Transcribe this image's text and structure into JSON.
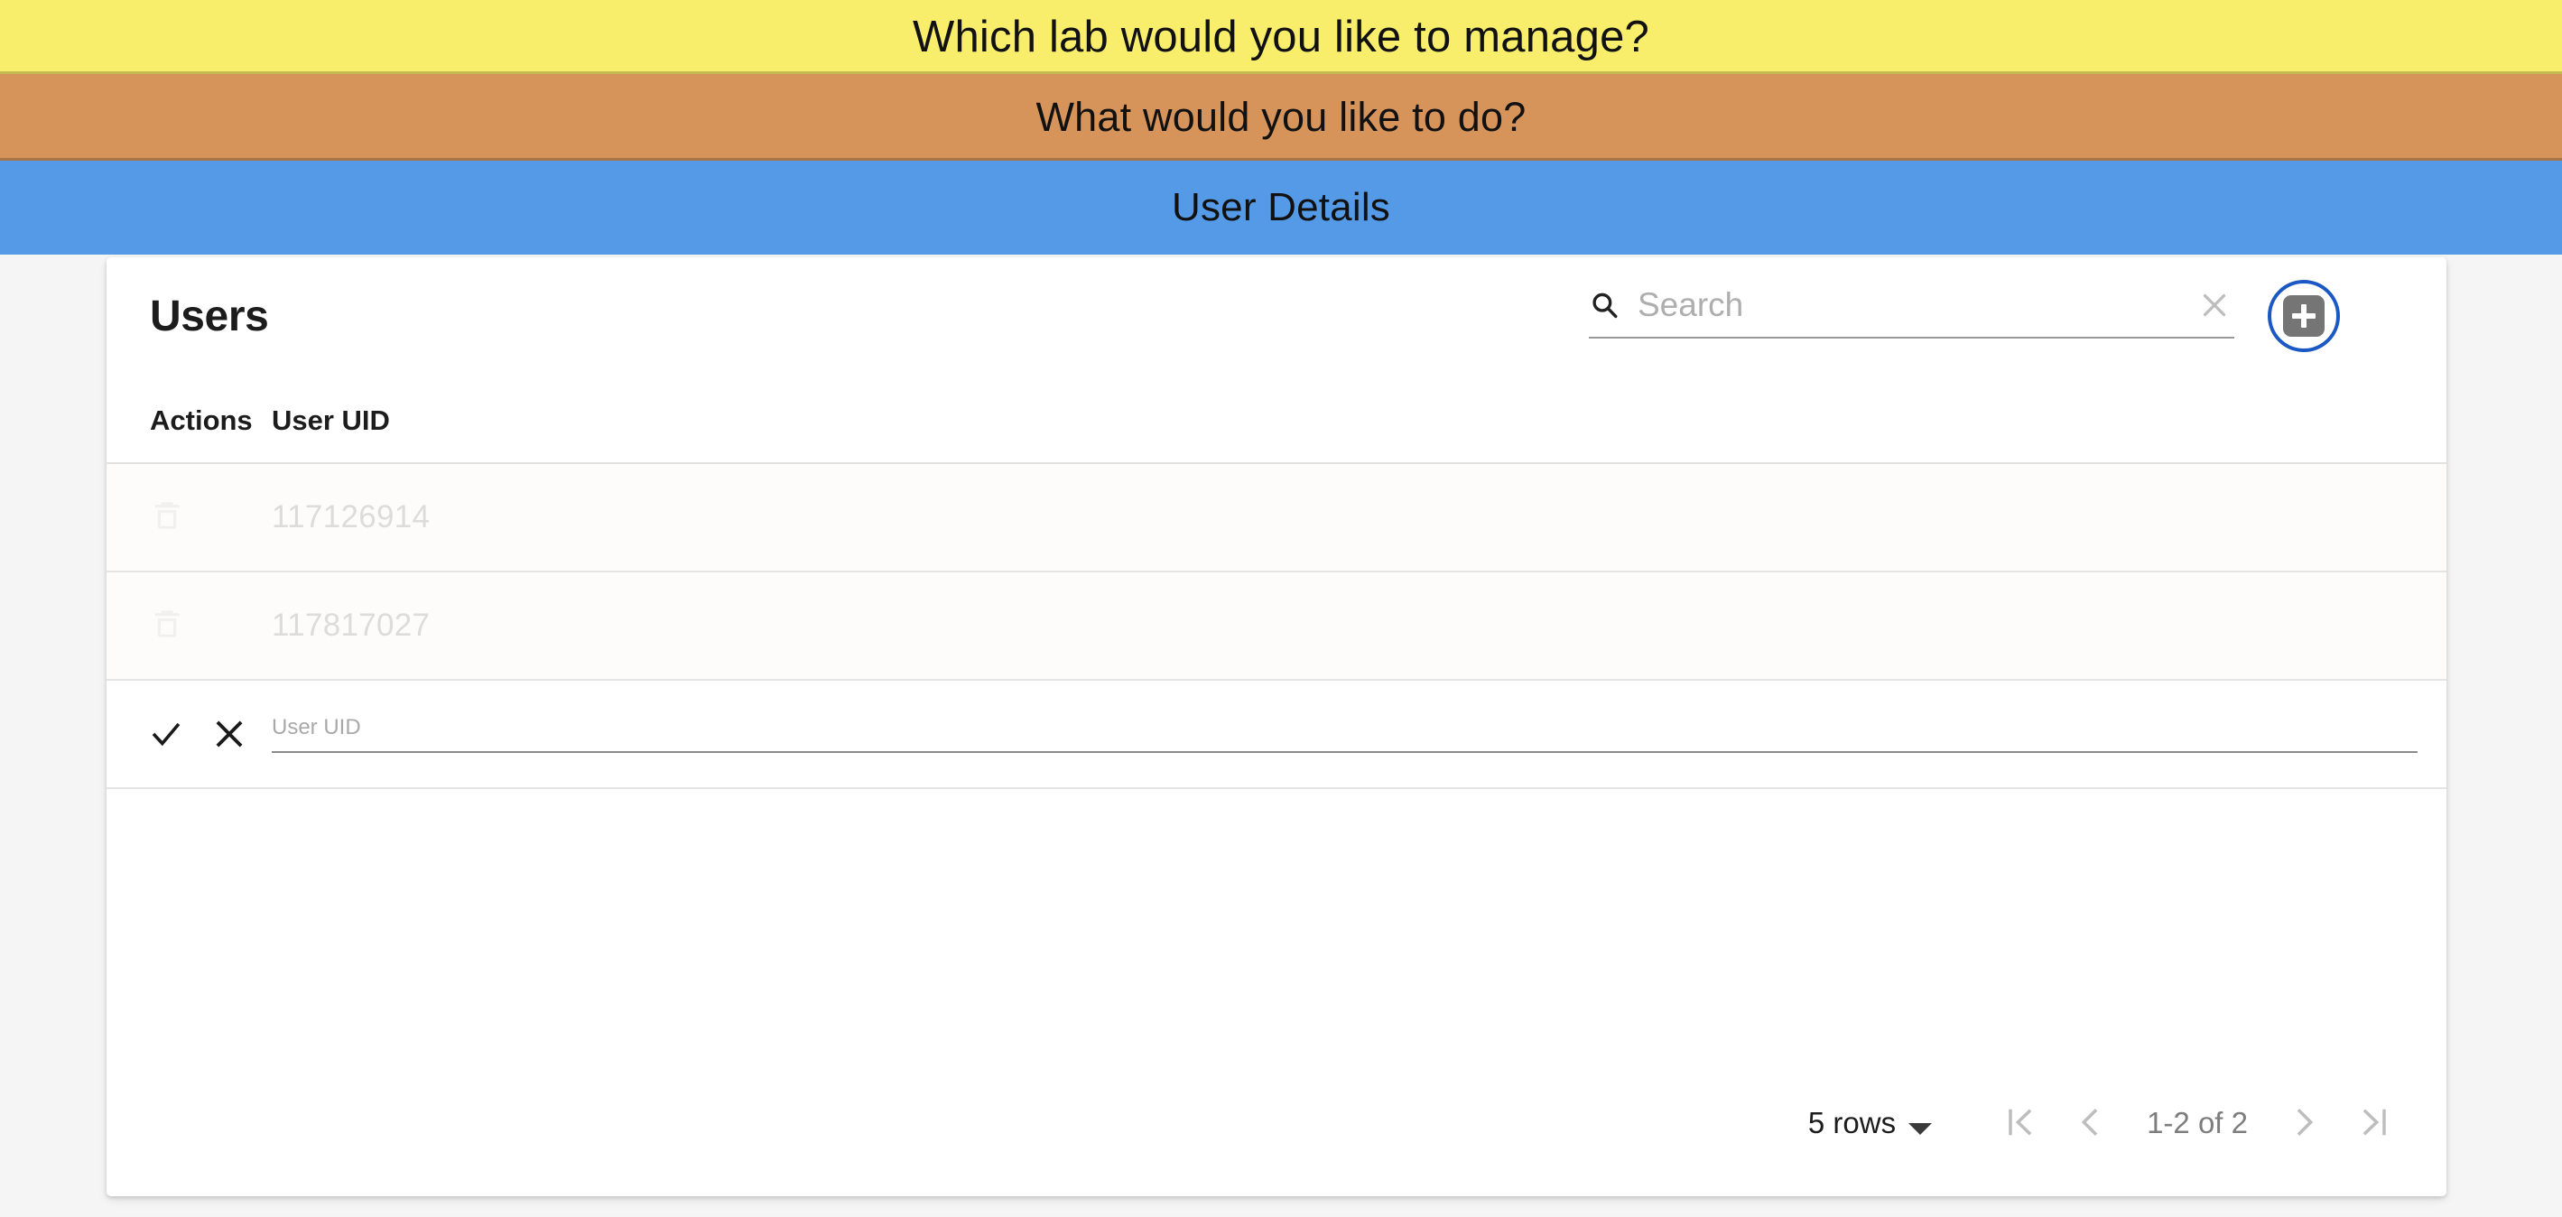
{
  "banners": [
    {
      "id": "lab-prompt",
      "text": "Which lab would you like to manage?",
      "color": "#f9ee6b"
    },
    {
      "id": "action-prompt",
      "text": "What would you like to do?",
      "color": "#d6945b"
    },
    {
      "id": "section-title",
      "text": "User Details",
      "color": "#549ae6"
    }
  ],
  "card": {
    "title": "Users",
    "search": {
      "placeholder": "Search",
      "value": "",
      "search_icon": "search-icon",
      "clear_icon": "close-icon"
    },
    "add_button": {
      "icon": "plus-icon",
      "label": "",
      "focus_ring_color": "#1a58c4",
      "button_color": "#757575"
    },
    "table": {
      "columns": [
        "Actions",
        "User UID"
      ],
      "rows": [
        {
          "uid": "117126914",
          "action_icon": "trash-icon"
        },
        {
          "uid": "117817027",
          "action_icon": "trash-icon"
        }
      ],
      "edit_row": {
        "confirm_icon": "check-icon",
        "cancel_icon": "close-icon",
        "input_placeholder": "User UID",
        "input_value": ""
      }
    },
    "pagination": {
      "rows_per_page_label": "5 rows",
      "range_label": "1-2 of 2",
      "first_page_icon": "first-page-icon",
      "prev_page_icon": "chevron-left-icon",
      "next_page_icon": "chevron-right-icon",
      "last_page_icon": "last-page-icon"
    }
  }
}
